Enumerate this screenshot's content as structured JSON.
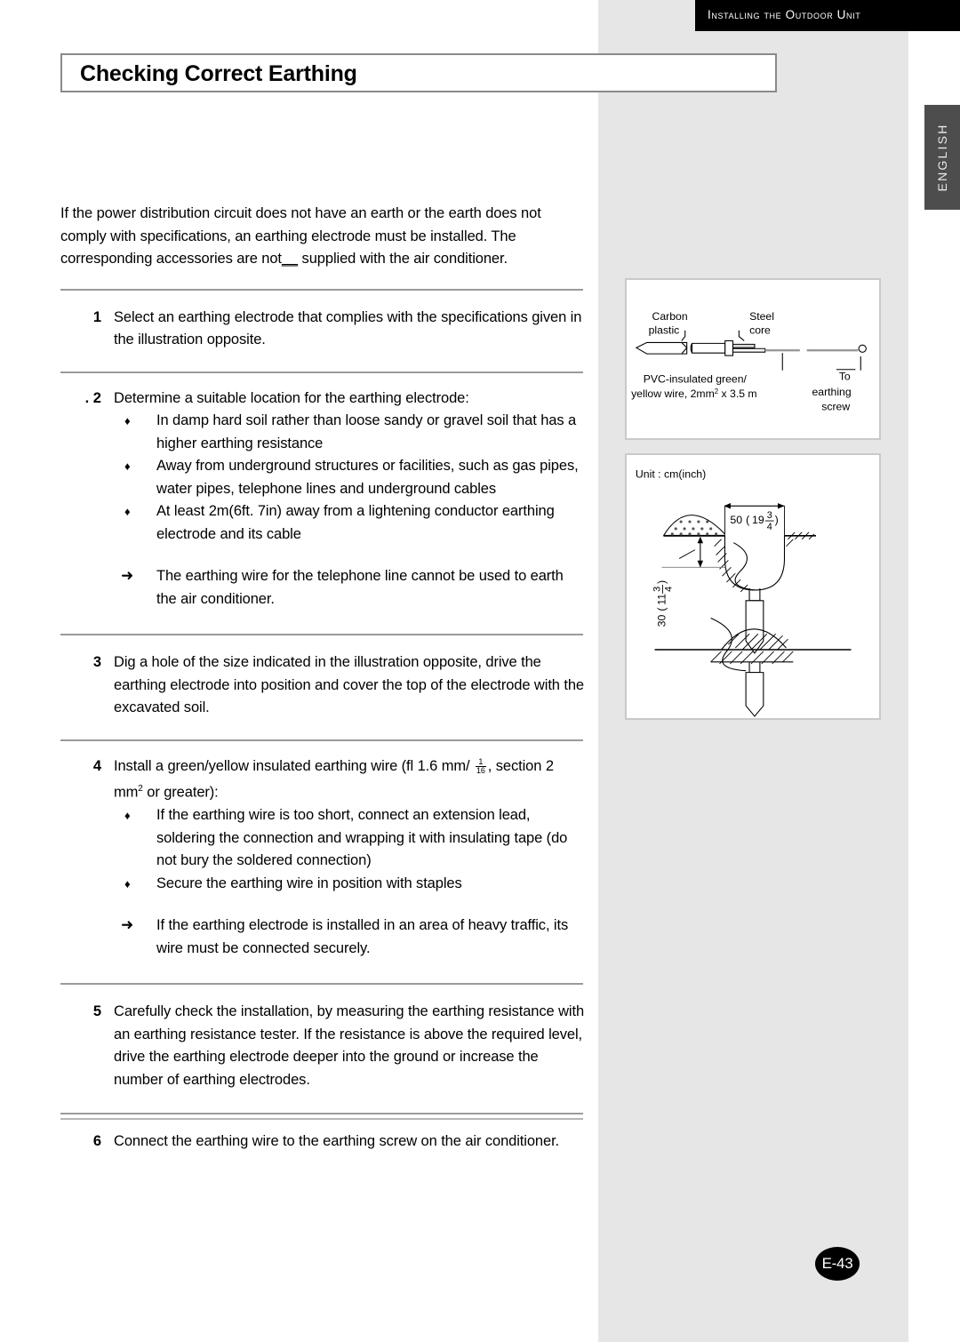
{
  "header": {
    "running_title": "Installing the Outdoor Unit",
    "language_tab": "ENGLISH"
  },
  "page_title": "Checking Correct Earthing",
  "intro": {
    "before": "If the power distribution circuit does not have an earth or the earth does not comply with specifications, an earthing electrode must be installed. The corresponding accessories are not",
    "marked": "__",
    "after": " supplied with the air conditioner."
  },
  "steps": [
    {
      "number": "1",
      "text": "Select an earthing electrode that complies with the specifications given in the illustration opposite.",
      "bullets": [],
      "notes": []
    },
    {
      "number": ". 2",
      "text": "Determine a suitable location for the earthing electrode:",
      "bullets": [
        "In damp hard soil rather than loose sandy or gravel soil that has a higher earthing resistance",
        "Away from underground structures or facilities, such as gas pipes, water pipes, telephone lines and underground cables",
        "At least 2m(6ft. 7in) away from a lightening conductor earthing electrode and its cable"
      ],
      "notes": [
        "The earthing wire for the telephone line cannot be used to earth the air conditioner."
      ]
    },
    {
      "number": "3",
      "text": "Dig a hole of the size indicated in the illustration opposite, drive the earthing electrode into position and cover the top of the electrode with the excavated soil.",
      "bullets": [],
      "notes": []
    },
    {
      "number": "4",
      "text_part1": "Install a green/yellow insulated earthing wire (fl 1.6 mm/",
      "fraction_numerator": "1",
      "fraction_denominator": "16",
      "text_part2": ", section 2 mm",
      "text_sup": "2",
      "text_part3": " or greater):",
      "bullets": [
        "If the earthing wire is too short, connect an extension lead, soldering the connection and wrapping it with insulating tape (do not bury the soldered connection)",
        "Secure the earthing wire in position with staples"
      ],
      "notes": [
        "If the earthing electrode is installed in an area of heavy traffic, its wire must be connected securely."
      ]
    },
    {
      "number": "5",
      "text": "Carefully check the installation, by measuring the earthing resistance with an earthing resistance tester. If the resistance is above the required level, drive the earthing electrode deeper into the ground or increase the number of earthing electrodes.",
      "bullets": [],
      "notes": []
    },
    {
      "number": "6",
      "text": "Connect the earthing wire to the earthing screw on the air conditioner.",
      "bullets": [],
      "notes": []
    }
  ],
  "bullet_glyph": "♦",
  "note_glyph": "➜",
  "illustration_electrode": {
    "label_carbon": "Carbon",
    "label_plastic": "plastic",
    "label_steel": "Steel",
    "label_core": "core",
    "label_wire_line1": "PVC-insulated green/",
    "label_wire_line2_a": "yellow wire, 2mm",
    "label_wire_line2_sup": "2",
    "label_wire_line2_b": " x 3.5 m",
    "label_to": "To",
    "label_earthing": "earthing",
    "label_screw": "screw"
  },
  "illustration_hole": {
    "unit_label": "Unit : cm(inch)",
    "width_value": "50",
    "width_inch_int": "19",
    "width_inch_num": "3",
    "width_inch_den": "4",
    "depth_value": "30",
    "depth_inch_int": "11",
    "depth_inch_num": "3",
    "depth_inch_den": "4"
  },
  "footer": {
    "page_number": "E-43"
  }
}
